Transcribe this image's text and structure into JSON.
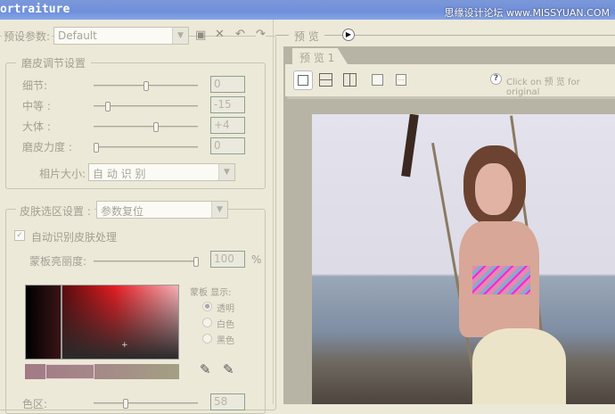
{
  "window": {
    "title": "ortraiture",
    "watermark": "思缘设计论坛 www.MISSYUAN.COM"
  },
  "preset": {
    "label": "预设参数:",
    "value": "Default",
    "icons": [
      "save-icon",
      "delete-icon",
      "undo-icon",
      "redo-icon"
    ]
  },
  "smoothing": {
    "title": "磨皮调节设置",
    "sliders": [
      {
        "label": "细节:",
        "value": "0",
        "pos": 0.5
      },
      {
        "label": "中等 :",
        "value": "-15",
        "pos": 0.12
      },
      {
        "label": "大体 :",
        "value": "+4",
        "pos": 0.6
      },
      {
        "label": "磨皮力度 :",
        "value": "0",
        "pos": 0.0
      }
    ],
    "photo_size_label": "相片大小:",
    "photo_size_value": "自 动 识 别"
  },
  "skin": {
    "title": "皮肤选区设置 :",
    "preset_value": "参数复位",
    "auto_checkbox": "自动识别皮肤处理",
    "auto_checked": true,
    "mask_brightness_label": "蒙板亮丽度:",
    "mask_brightness_value": "100",
    "mask_brightness_pos": 1.0,
    "percent": "%",
    "mask_display_label": "蒙板 显示:",
    "radios": [
      "透明",
      "白色",
      "黑色"
    ],
    "selected_radio": 0,
    "hue_label": "色区:",
    "hue_value": "58",
    "hue_pos": 0.35
  },
  "preview": {
    "label": "预 览",
    "tab": "预 览 1",
    "hint": "Click on 预 览 for original",
    "view_icons": [
      "single-view-icon",
      "split-horizontal-icon",
      "split-vertical-icon",
      "new-preview-icon",
      "snapshot-icon"
    ]
  }
}
